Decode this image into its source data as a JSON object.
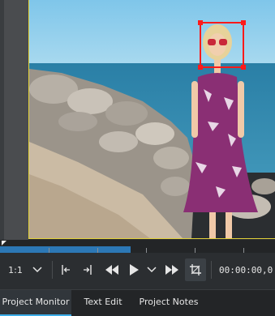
{
  "monitor": {
    "title": "Project Monitor"
  },
  "toolbar": {
    "zoom_value": "1:1",
    "timecode": "00:00:00,0"
  },
  "tabs": [
    {
      "label": "Project Monitor",
      "active": true
    },
    {
      "label": "Text Edit",
      "active": false
    },
    {
      "label": "Project Notes",
      "active": false
    }
  ],
  "colors": {
    "accent": "#3daee9",
    "progress": "#2c78b6",
    "face_box": "#ff1a1a",
    "monitor_border": "#e3d23a"
  },
  "playback": {
    "progress_fraction": 0.47
  }
}
